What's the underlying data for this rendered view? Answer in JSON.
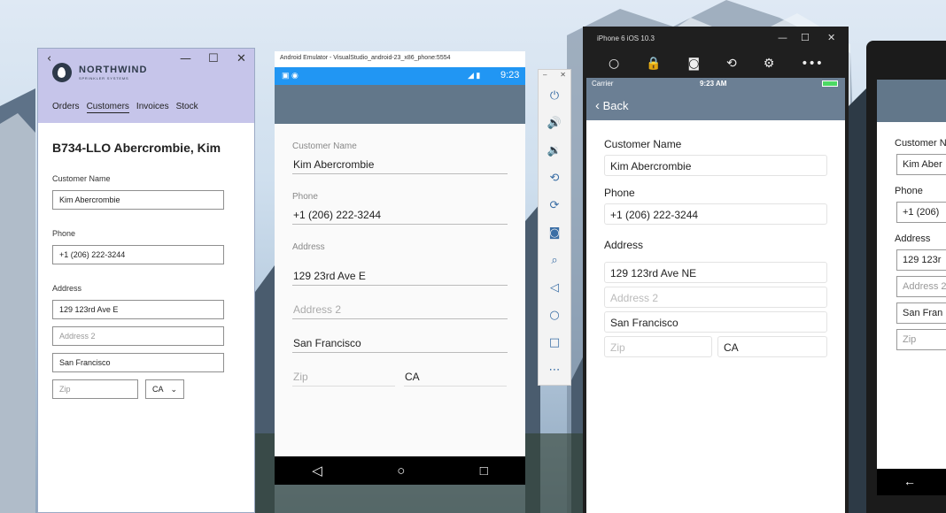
{
  "uwp": {
    "brand_name": "NORTHWIND",
    "brand_sub": "SPRINKLER SYSTEMS",
    "nav": [
      "Orders",
      "Customers",
      "Invoices",
      "Stock"
    ],
    "title": "B734-LLO Abercrombie, Kim",
    "customer_name_label": "Customer Name",
    "customer_name": "Kim Abercrombie",
    "phone_label": "Phone",
    "phone": "+1 (206) 222-3244",
    "address_label": "Address",
    "address1": "129 123rd Ave E",
    "address2_placeholder": "Address 2",
    "city": "San Francisco",
    "zip_placeholder": "Zip",
    "state": "CA"
  },
  "android": {
    "window_title": "Android Emulator - VisualStudio_android-23_x86_phone:5554",
    "time": "9:23",
    "customer_name_label": "Customer Name",
    "customer_name": "Kim Abercrombie",
    "phone_label": "Phone",
    "phone": "+1 (206) 222-3244",
    "address_label": "Address",
    "address1": "129 23rd Ave E",
    "address2_placeholder": "Address 2",
    "city": "San Francisco",
    "zip_placeholder": "Zip",
    "state": "CA"
  },
  "ios": {
    "window_title": "iPhone 6 iOS 10.3",
    "carrier": "Carrier",
    "time": "9:23 AM",
    "back_label": "Back",
    "customer_name_label": "Customer Name",
    "customer_name": "Kim Abercrombie",
    "phone_label": "Phone",
    "phone": "+1 (206) 222-3244",
    "address_label": "Address",
    "address1": "129 123rd Ave NE",
    "address2_placeholder": "Address 2",
    "city": "San Francisco",
    "zip_placeholder": "Zip",
    "state": "CA"
  },
  "device": {
    "customer_name_label": "Customer N",
    "customer_name": "Kim Aber",
    "phone_label": "Phone",
    "phone": "+1 (206)",
    "address_label": "Address",
    "address1": "129 123r",
    "address2_placeholder": "Address 2",
    "city": "San Fran",
    "zip_placeholder": "Zip"
  },
  "colors": {
    "uwp_header": "#c6c5ea",
    "android_status": "#2196f3",
    "app_bar": "#62778a",
    "ios_nav": "#6b7f94"
  }
}
